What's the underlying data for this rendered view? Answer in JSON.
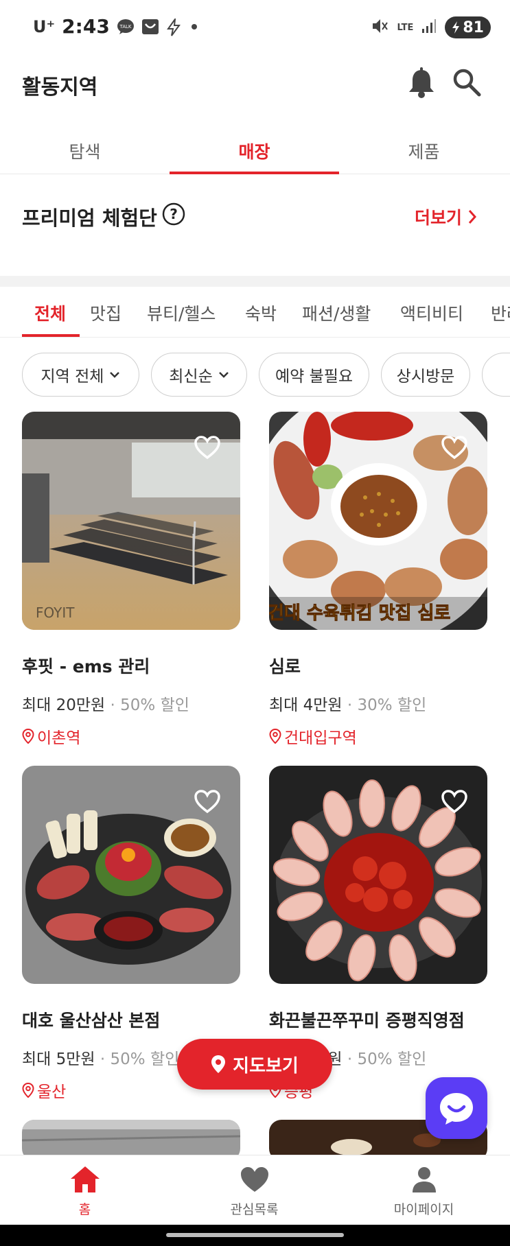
{
  "status": {
    "carrier": "U⁺",
    "time": "2:43",
    "network": "LTE",
    "battery": "81"
  },
  "header": {
    "title": "활동지역"
  },
  "tabs": [
    {
      "label": "탐색"
    },
    {
      "label": "매장"
    },
    {
      "label": "제품"
    }
  ],
  "premium": {
    "title": "프리미엄 체험단",
    "more": "더보기"
  },
  "categories": [
    {
      "label": "전체"
    },
    {
      "label": "맛집"
    },
    {
      "label": "뷰티/헬스"
    },
    {
      "label": "숙박"
    },
    {
      "label": "패션/생활"
    },
    {
      "label": "액티비티"
    },
    {
      "label": "반려"
    }
  ],
  "filters": [
    {
      "label": "지역 전체"
    },
    {
      "label": "최신순"
    },
    {
      "label": "예약 불필요"
    },
    {
      "label": "상시방문"
    }
  ],
  "cards": [
    {
      "title": "후핏 - ems 관리",
      "price": "최대 20만원",
      "discount": "50% 할인",
      "location": "이촌역",
      "image_text": ""
    },
    {
      "title": "심로",
      "price": "최대 4만원",
      "discount": "30% 할인",
      "location": "건대입구역",
      "image_text": "건대 수육튀김 맛집 심로"
    },
    {
      "title": "대호 울산삼산 본점",
      "price": "최대 5만원",
      "discount": "50% 할인",
      "location": "울산",
      "image_text": ""
    },
    {
      "title": "화끈불끈쭈꾸미 증평직영점",
      "price": "최대 5만원",
      "discount": "50% 할인",
      "location": "증평",
      "image_text": ""
    }
  ],
  "map_button": {
    "label": "지도보기"
  },
  "bottom_nav": [
    {
      "label": "홈"
    },
    {
      "label": "관심목록"
    },
    {
      "label": "마이페이지"
    }
  ],
  "colors": {
    "accent": "#e3242b",
    "chat": "#5b3df5"
  }
}
